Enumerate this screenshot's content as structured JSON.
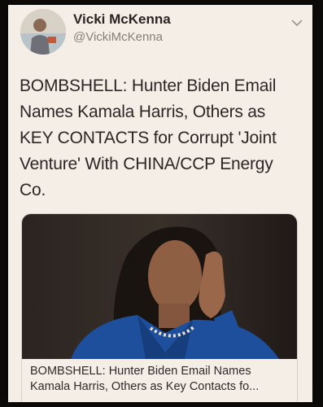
{
  "author": {
    "display_name": "Vicki McKenna",
    "handle": "@VickiMcKenna",
    "avatar_icon": "profile-photo"
  },
  "menu_icon": "chevron-down-icon",
  "tweet": {
    "lines": [
      "BOMBSHELL: Hunter Biden Email",
      "Names Kamala Harris, Others as",
      "KEY CONTACTS for Corrupt 'Joint",
      "Venture' With CHINA/CCP Energy",
      "Co."
    ]
  },
  "link_preview": {
    "image_icon": "article-photo",
    "title_lines": [
      "BOMBSHELL: Hunter Biden Email Names",
      "Kamala Harris, Others as Key Contacts fo..."
    ]
  },
  "colors": {
    "card_background": "#f4eee6",
    "text": "#2d2624",
    "secondary_text": "#857f78",
    "photo_jacket": "#1e4f9c"
  }
}
